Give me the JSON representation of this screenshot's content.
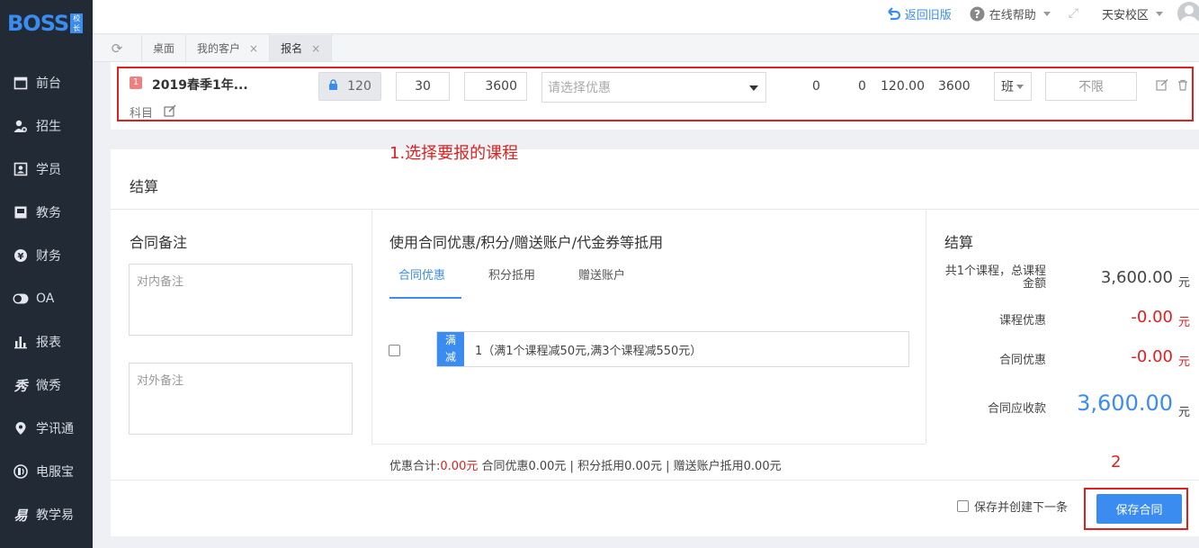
{
  "brand": {
    "logo_text": "BOSS",
    "logo_tag": "校长"
  },
  "sidebar": {
    "items": [
      {
        "label": "前台",
        "icon": "calendar-icon"
      },
      {
        "label": "招生",
        "icon": "add-user-icon"
      },
      {
        "label": "学员",
        "icon": "id-card-icon"
      },
      {
        "label": "教务",
        "icon": "book-icon"
      },
      {
        "label": "财务",
        "icon": "yen-icon"
      },
      {
        "label": "OA",
        "icon": "toggle-icon"
      },
      {
        "label": "报表",
        "icon": "bar-chart-icon"
      },
      {
        "label": "微秀",
        "icon": "wei-xiu-icon"
      },
      {
        "label": "学讯通",
        "icon": "location-pin-icon"
      },
      {
        "label": "电服宝",
        "icon": "phone-service-icon"
      },
      {
        "label": "教学易",
        "icon": "teaching-icon"
      }
    ]
  },
  "header": {
    "back_old": "返回旧版",
    "help": "在线帮助",
    "campus": "天安校区"
  },
  "tabs": [
    {
      "label": "桌面",
      "closable": false,
      "active": false
    },
    {
      "label": "我的客户",
      "closable": true,
      "active": false
    },
    {
      "label": "报名",
      "closable": true,
      "active": true
    }
  ],
  "course_row": {
    "badge": "1",
    "name": "2019春季1年...",
    "subject_label": "科目",
    "locked_hours": "120",
    "input_a": "30",
    "input_b": "3600",
    "discount_placeholder": "请选择优惠",
    "val_1": "0",
    "val_2": "0",
    "val_3": "120.00",
    "val_4": "3600",
    "class_type": "班",
    "limit": "不限"
  },
  "annotations": {
    "step1": "1.选择要报的课程",
    "step2": "2"
  },
  "settlement": {
    "title": "结算",
    "notes": {
      "title": "合同备注",
      "internal_placeholder": "对内备注",
      "external_placeholder": "对外备注"
    },
    "discounts": {
      "title": "使用合同优惠/积分/赠送账户/代金券等抵用",
      "tabs": [
        "合同优惠",
        "积分抵用",
        "赠送账户"
      ],
      "tag_line1": "满",
      "tag_line2": "减",
      "rule": "1（满1个课程减50元,满3个课程减550元）",
      "summary_prefix": "优惠合计:",
      "summary_amount": "0.00元",
      "summary_rest": " 合同优惠0.00元 | 积分抵用0.00元 | 赠送账户抵用0.00元"
    },
    "summary": {
      "title": "结算",
      "total_label_1": "共1个课程，总课程",
      "total_label_2": "金额",
      "total_value": "3,600.00",
      "course_disc_label": "课程优惠",
      "course_disc_value": "-0.00",
      "contract_disc_label": "合同优惠",
      "contract_disc_value": "-0.00",
      "receivable_label": "合同应收款",
      "receivable_value": "3,600.00",
      "unit": "元"
    },
    "save_next": "保存并创建下一条",
    "save": "保存合同"
  },
  "colors": {
    "accent": "#3b8cf0",
    "sidebar": "#222a35",
    "annotation": "#e02020"
  }
}
